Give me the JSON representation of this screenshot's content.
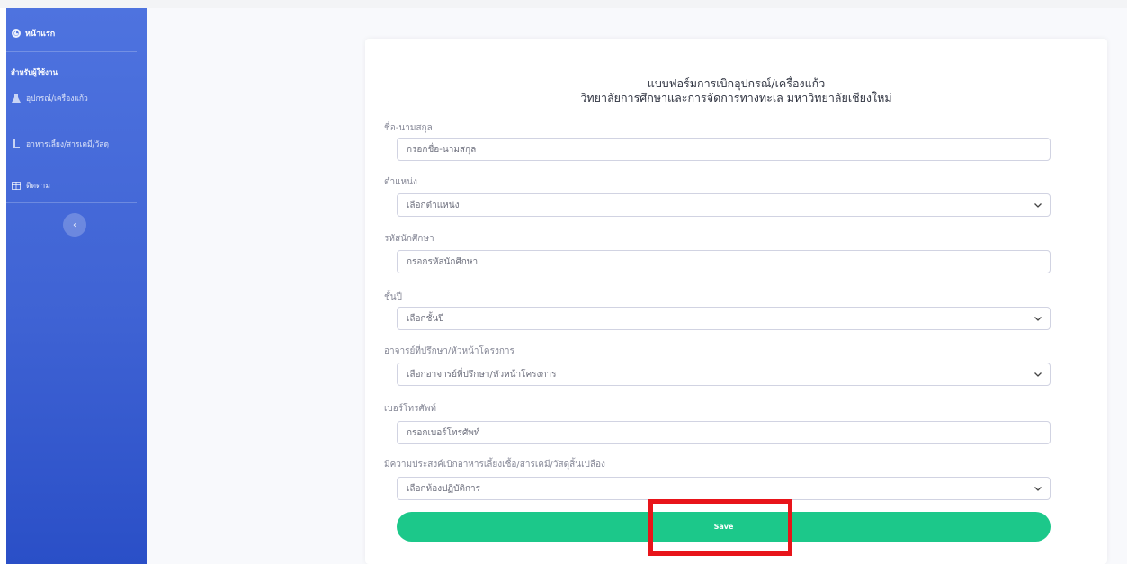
{
  "sidebar": {
    "home_label": "หน้าแรก",
    "section_heading": "สำหรับผู้ใช้งาน",
    "items": [
      {
        "label": "อุปกรณ์/เครื่องแก้ว",
        "icon": "flask-icon"
      },
      {
        "label": "อาหารเลี้ยง/สารเคมี/วัสดุ",
        "icon": "beaker-icon"
      },
      {
        "label": "ติดตาม",
        "icon": "table-icon"
      }
    ],
    "toggle_icon": "‹"
  },
  "form": {
    "title_line1": "แบบฟอร์มการเบิกอุปกรณ์/เครื่องแก้ว",
    "title_line2": "วิทยาลัยการศึกษาและการจัดการทางทะเล มหาวิทยาลัยเชียงใหม่",
    "fields": [
      {
        "label": "ชื่อ-นามสกุล",
        "type": "text",
        "placeholder": "กรอกชื่อ-นามสกุล"
      },
      {
        "label": "ตำแหน่ง",
        "type": "select",
        "selected": "เลือกตำแหน่ง"
      },
      {
        "label": "รหัสนักศึกษา",
        "type": "text",
        "placeholder": "กรอกรหัสนักศึกษา"
      },
      {
        "label": "ชั้นปี",
        "type": "select",
        "selected": "เลือกชั้นปี"
      },
      {
        "label": "อาจารย์ที่ปรึกษา/หัวหน้าโครงการ",
        "type": "select",
        "selected": "เลือกอาจารย์ที่ปรึกษา/หัวหน้าโครงการ"
      },
      {
        "label": "เบอร์โทรศัพท์",
        "type": "text",
        "placeholder": "กรอกเบอร์โทรศัพท์"
      },
      {
        "label": "มีความประสงค์เบิกอาหารเลี้ยงเชื้อ/สารเคมี/วัสดุสิ้นเปลือง",
        "type": "select",
        "selected": "เลือกห้องปฏิบัติการ"
      }
    ],
    "save_label": "Save"
  },
  "colors": {
    "sidebar": "#4e73df",
    "save_button": "#1cc88a",
    "highlight": "#e8141a"
  }
}
